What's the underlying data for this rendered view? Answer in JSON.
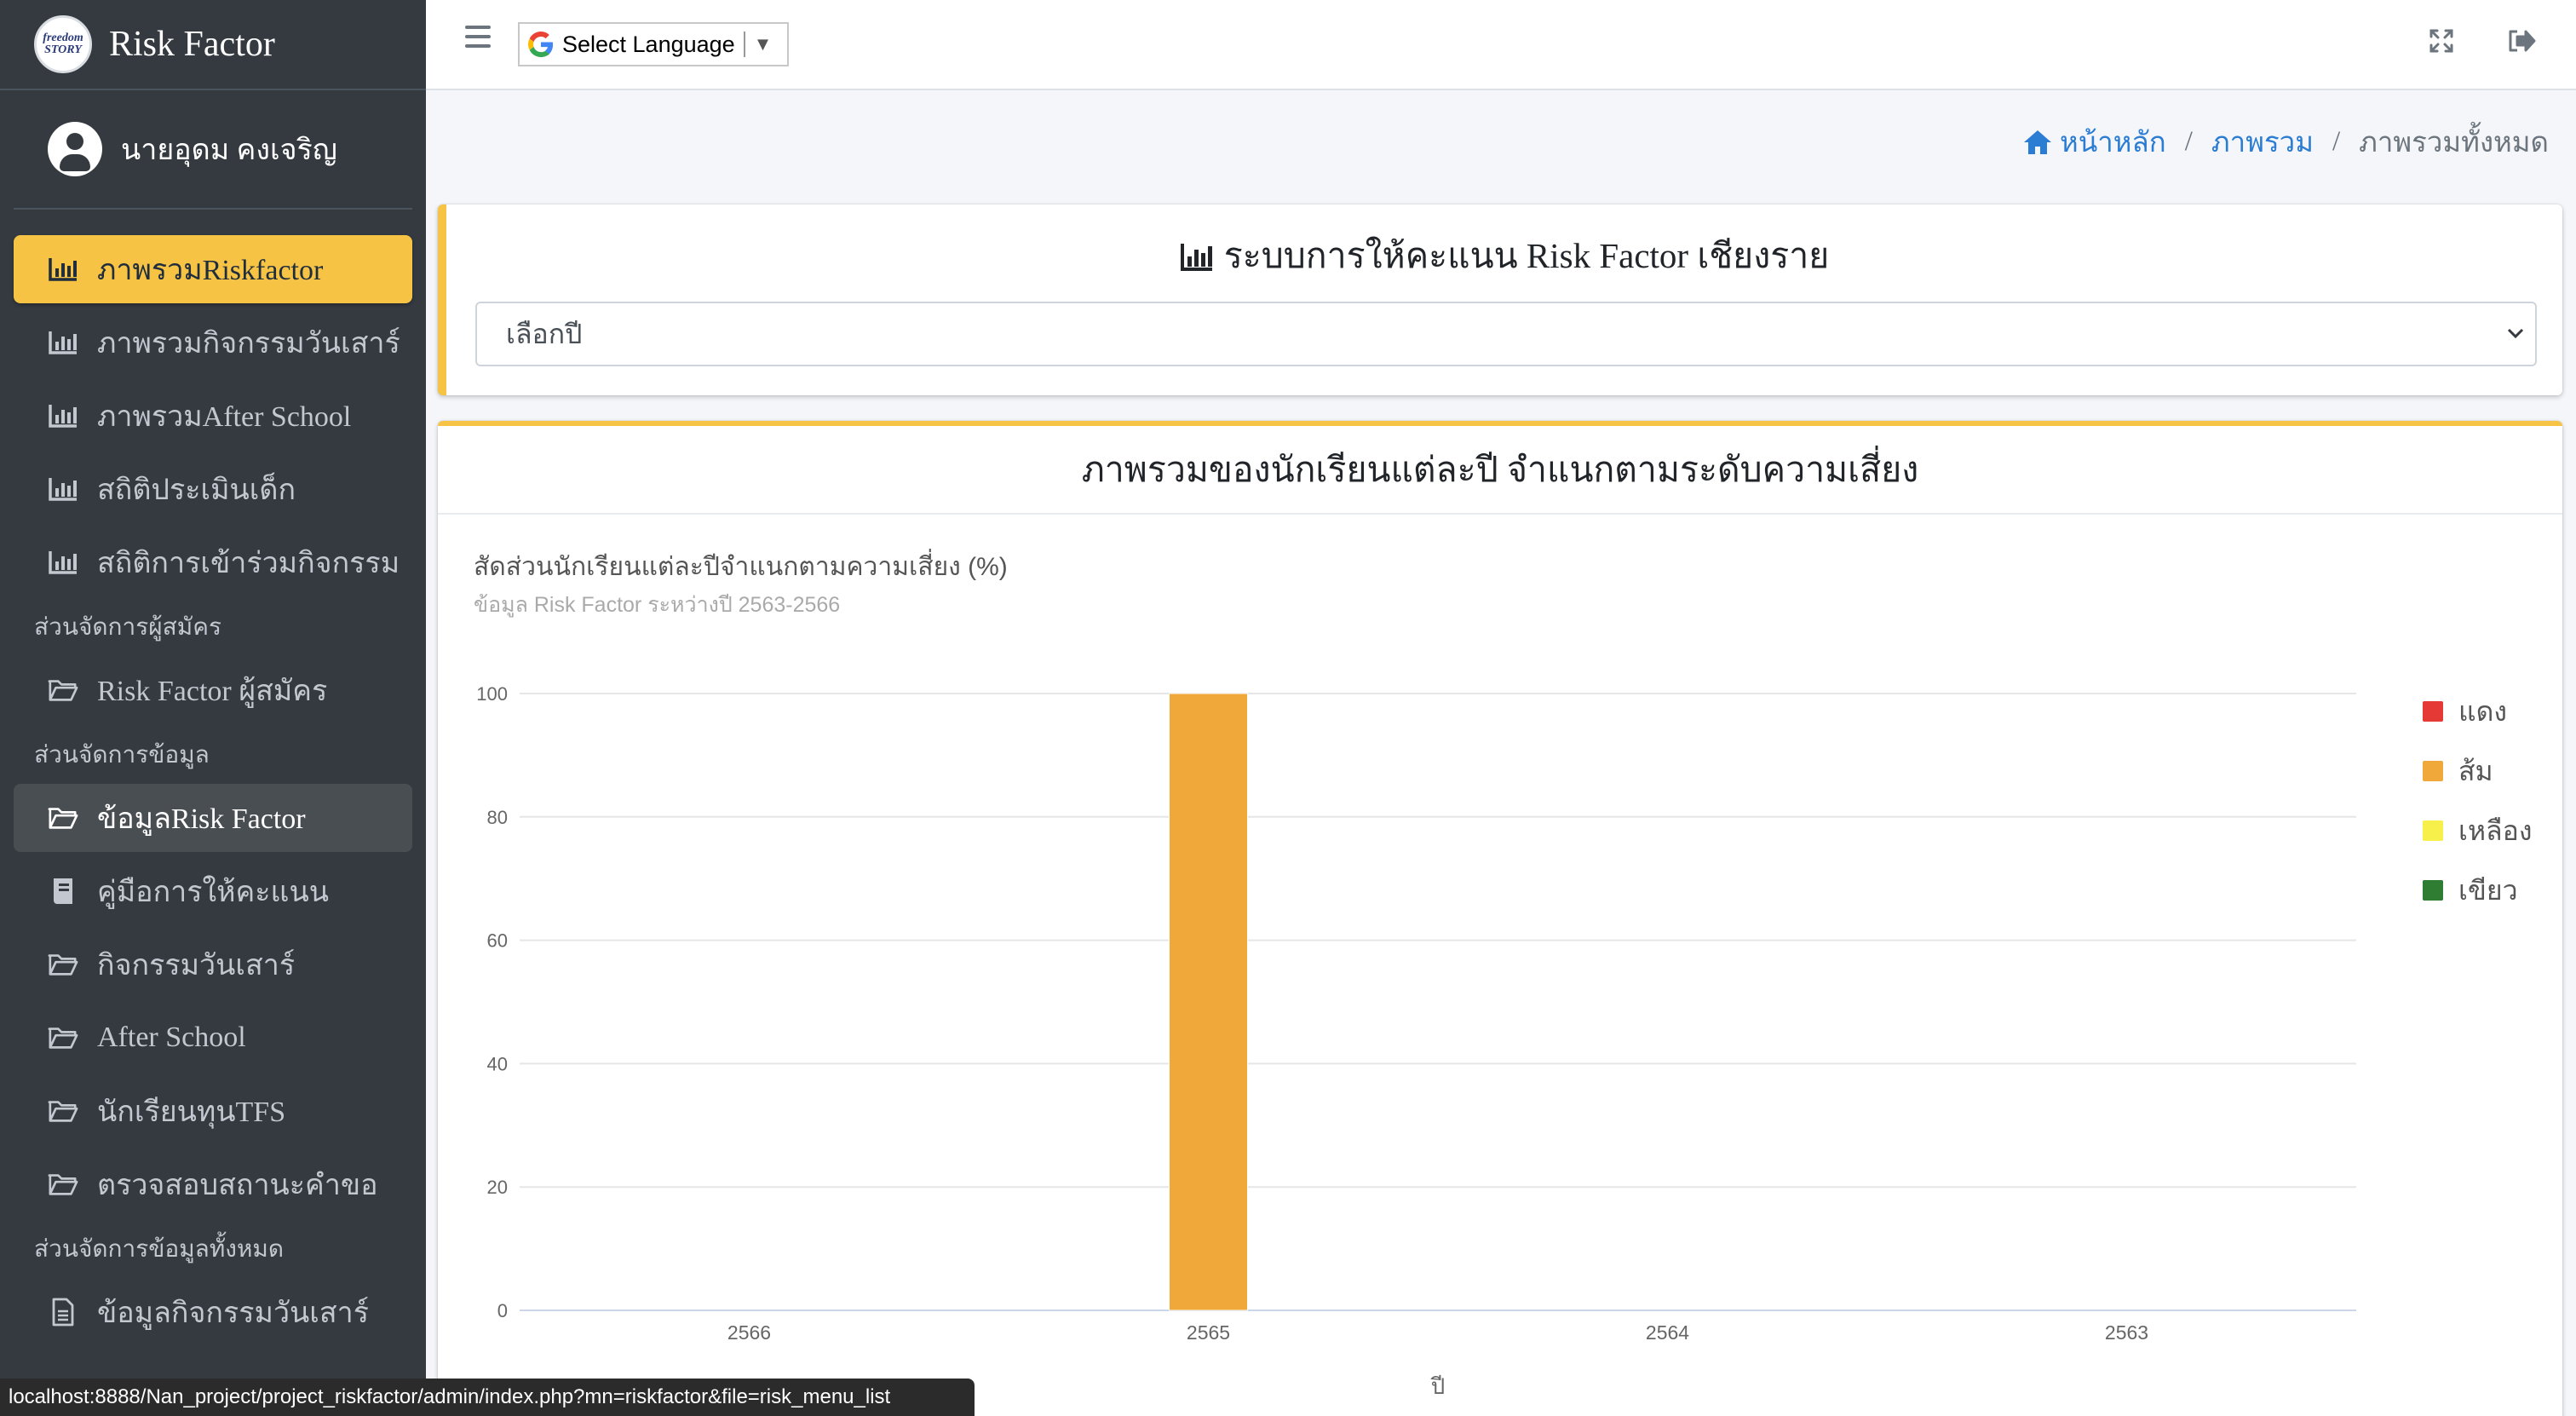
{
  "brand": {
    "title": "Risk Factor",
    "logo_text": "freedom STORY"
  },
  "user": {
    "name": "นายอุดม คงเจริญ"
  },
  "sidebar": {
    "items_top": [
      {
        "label": "ภาพรวมRiskfactor",
        "icon": "chart-icon",
        "state": "active"
      },
      {
        "label": "ภาพรวมกิจกรรมวันเสาร์",
        "icon": "chart-icon",
        "state": ""
      },
      {
        "label": "ภาพรวมAfter School",
        "icon": "chart-icon",
        "state": ""
      },
      {
        "label": "สถิติประเมินเด็ก",
        "icon": "chart-icon",
        "state": ""
      },
      {
        "label": "สถิติการเข้าร่วมกิจกรรม",
        "icon": "chart-icon",
        "state": ""
      }
    ],
    "header_applicants": "ส่วนจัดการผู้สมัคร",
    "items_applicants": [
      {
        "label": "Risk Factor ผู้สมัคร",
        "icon": "folder-icon"
      }
    ],
    "header_data": "ส่วนจัดการข้อมูล",
    "items_data": [
      {
        "label": "ข้อมูลRisk Factor",
        "icon": "folder-icon",
        "state": "selected"
      },
      {
        "label": "คู่มือการให้คะแนน",
        "icon": "book-icon",
        "state": ""
      },
      {
        "label": "กิจกรรมวันเสาร์",
        "icon": "folder-icon",
        "state": ""
      },
      {
        "label": "After School",
        "icon": "folder-icon",
        "state": ""
      },
      {
        "label": "นักเรียนทุนTFS",
        "icon": "folder-icon",
        "state": ""
      },
      {
        "label": "ตรวจสอบสถานะคำขอ",
        "icon": "folder-icon",
        "state": ""
      }
    ],
    "header_all": "ส่วนจัดการข้อมูลทั้งหมด",
    "items_all": [
      {
        "label": "ข้อมูลกิจกรรมวันเสาร์",
        "icon": "file-icon"
      }
    ]
  },
  "topbar": {
    "language_label": "Select Language"
  },
  "breadcrumb": {
    "home": "หน้าหลัก",
    "overview": "ภาพรวม",
    "current": "ภาพรวมทั้งหมด"
  },
  "card1": {
    "title": "ระบบการให้คะแนน Risk Factor เชียงราย",
    "select_placeholder": "เลือกปี"
  },
  "card2": {
    "header": "ภาพรวมของนักเรียนแต่ละปี จำแนกตามระดับความเสี่ยง",
    "chart_title": "สัดส่วนนักเรียนแต่ละปีจำแนกตามความเสี่ยง (%)",
    "chart_subtitle": "ข้อมูล Risk Factor ระหว่างปี 2563-2566"
  },
  "status_url": "localhost:8888/Nan_project/project_riskfactor/admin/index.php?mn=riskfactor&file=risk_menu_list",
  "chart_data": {
    "type": "bar",
    "stacked": true,
    "categories": [
      "2566",
      "2565",
      "2564",
      "2563"
    ],
    "xlabel": "ปี",
    "ylabel": "",
    "ylim": [
      0,
      100
    ],
    "yticks": [
      0,
      20,
      40,
      60,
      80,
      100
    ],
    "grid": true,
    "legend_position": "right",
    "series": [
      {
        "name": "แดง",
        "color": "#e53935",
        "values": [
          0,
          0,
          0,
          0
        ]
      },
      {
        "name": "ส้ม",
        "color": "#f0a83a",
        "values": [
          0,
          100,
          0,
          0
        ]
      },
      {
        "name": "เหลือง",
        "color": "#f8f04a",
        "values": [
          0,
          0,
          0,
          0
        ]
      },
      {
        "name": "เขียว",
        "color": "#2e7d32",
        "values": [
          0,
          0,
          0,
          0
        ]
      }
    ]
  }
}
